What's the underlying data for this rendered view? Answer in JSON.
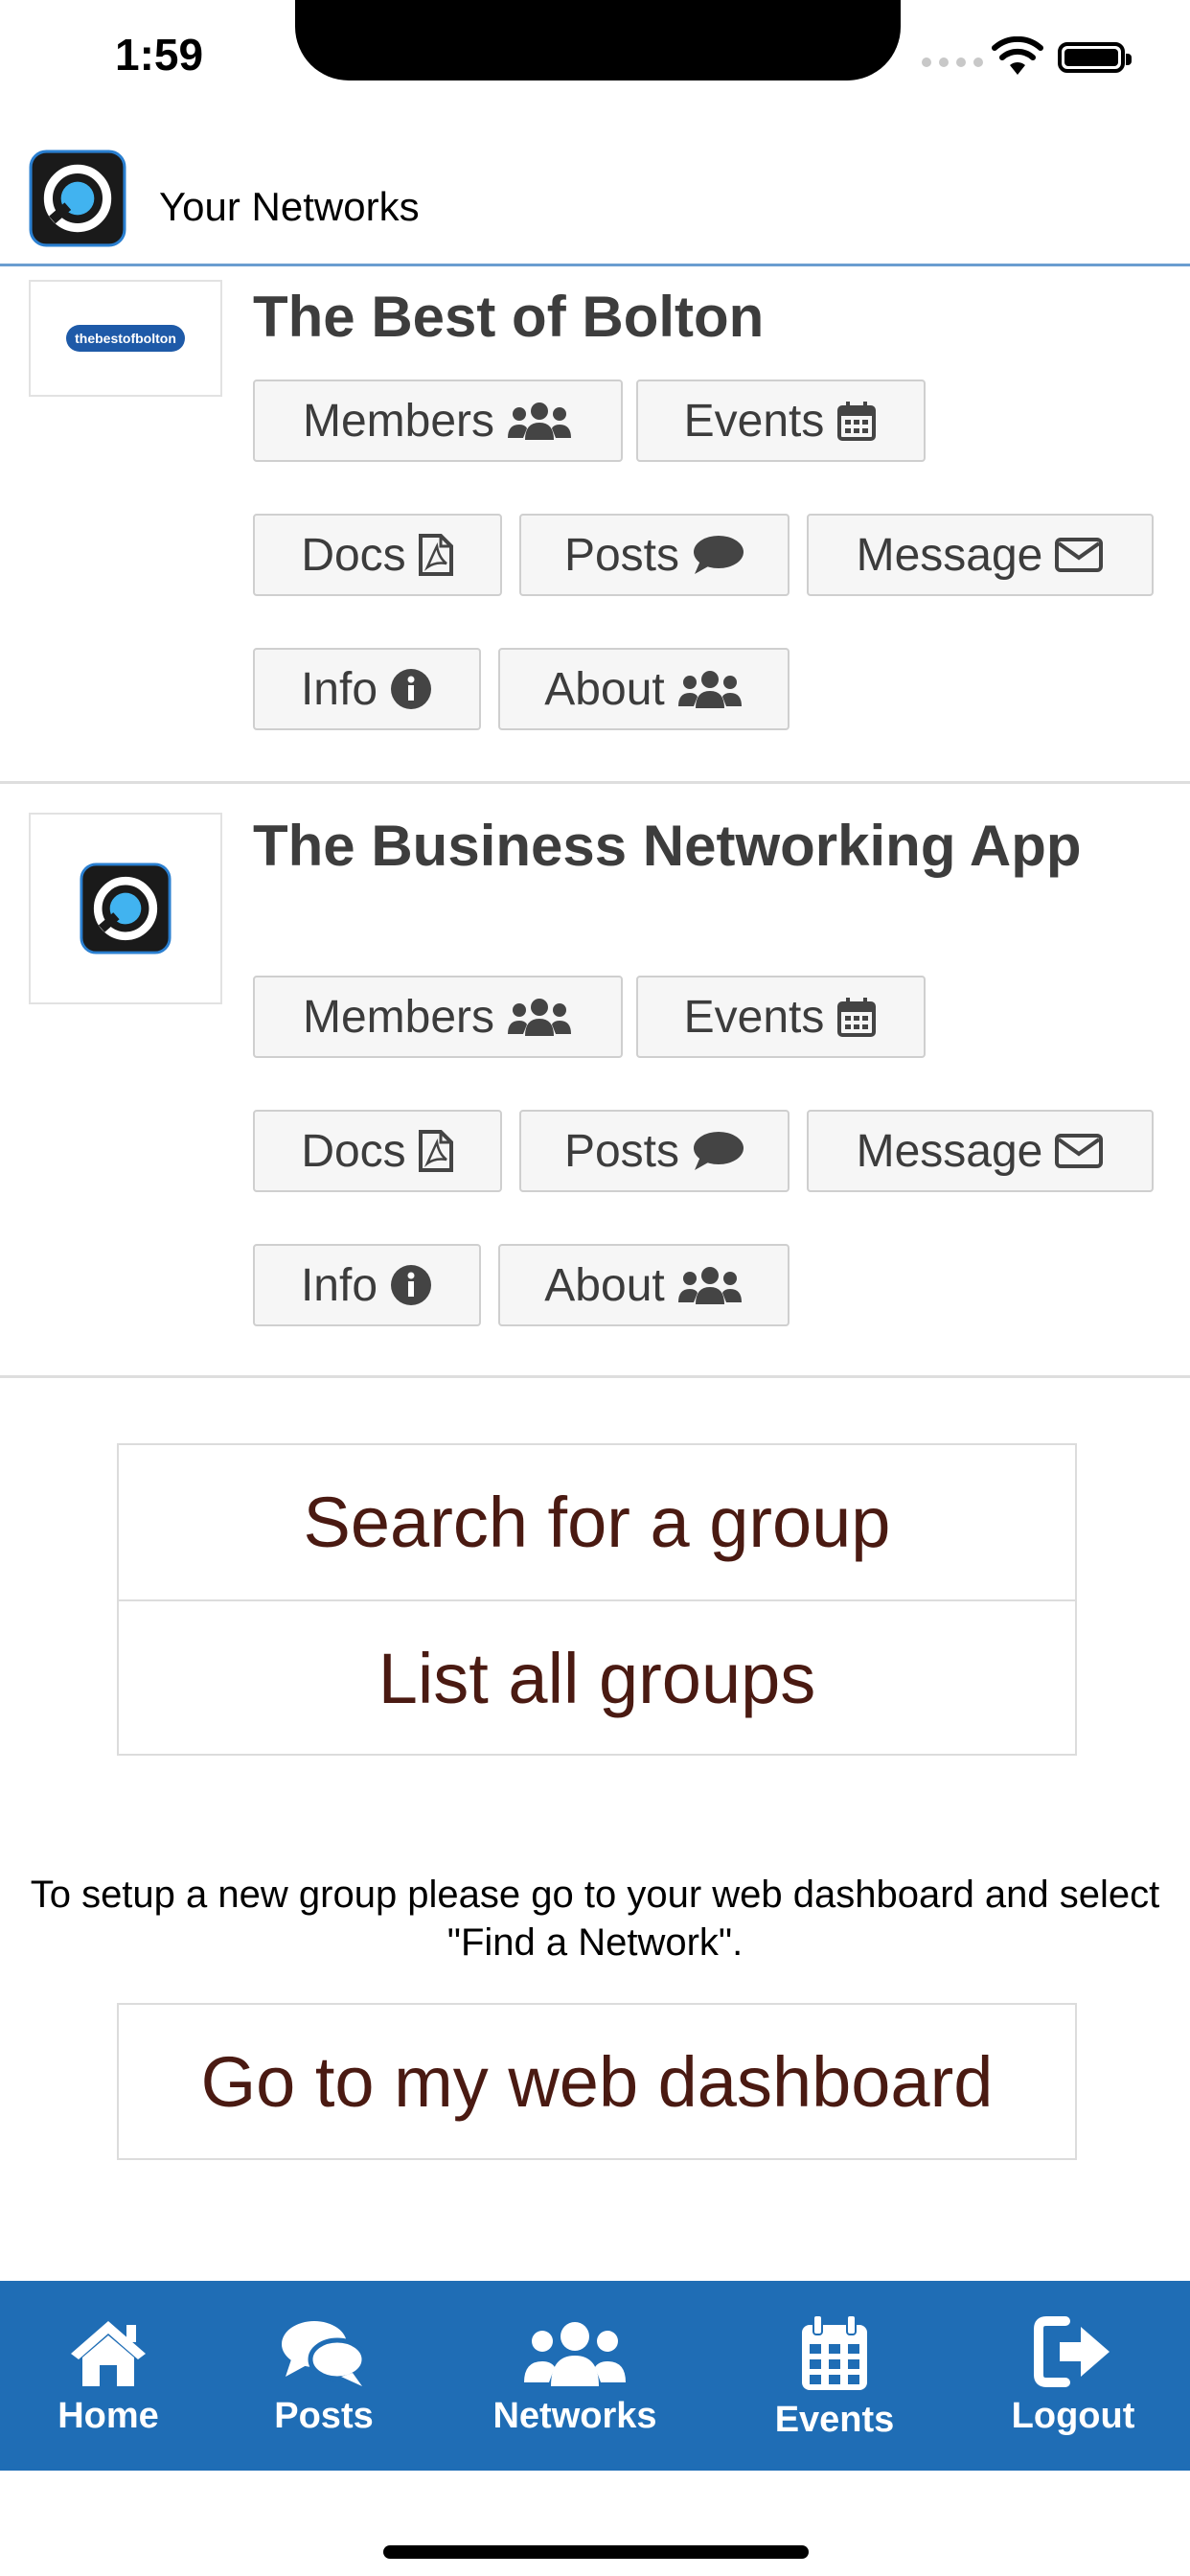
{
  "status_bar": {
    "time": "1:59"
  },
  "header": {
    "title": "Your Networks"
  },
  "networks": [
    {
      "title": "The Best of Bolton",
      "logo_text": "thebestofbolton",
      "buttons": {
        "members": "Members",
        "events": "Events",
        "docs": "Docs",
        "posts": "Posts",
        "message": "Message",
        "info": "Info",
        "about": "About"
      }
    },
    {
      "title": "The Business Networking App",
      "buttons": {
        "members": "Members",
        "events": "Events",
        "docs": "Docs",
        "posts": "Posts",
        "message": "Message",
        "info": "Info",
        "about": "About"
      }
    }
  ],
  "groups": {
    "search": "Search for a group",
    "list_all": "List all groups"
  },
  "setup_note": "To setup a new group please go to your web dashboard and select \"Find a Network\".",
  "dashboard_button": "Go to my web dashboard",
  "tabs": [
    {
      "label": "Home",
      "icon": "home-icon"
    },
    {
      "label": "Posts",
      "icon": "comments-icon"
    },
    {
      "label": "Networks",
      "icon": "users-icon"
    },
    {
      "label": "Events",
      "icon": "calendar-icon"
    },
    {
      "label": "Logout",
      "icon": "logout-icon"
    }
  ],
  "colors": {
    "tab_bar": "#1f6db5",
    "header_rule": "#6a9dd0",
    "network_title": "#3d3d3d",
    "group_text": "#4a1a12"
  }
}
